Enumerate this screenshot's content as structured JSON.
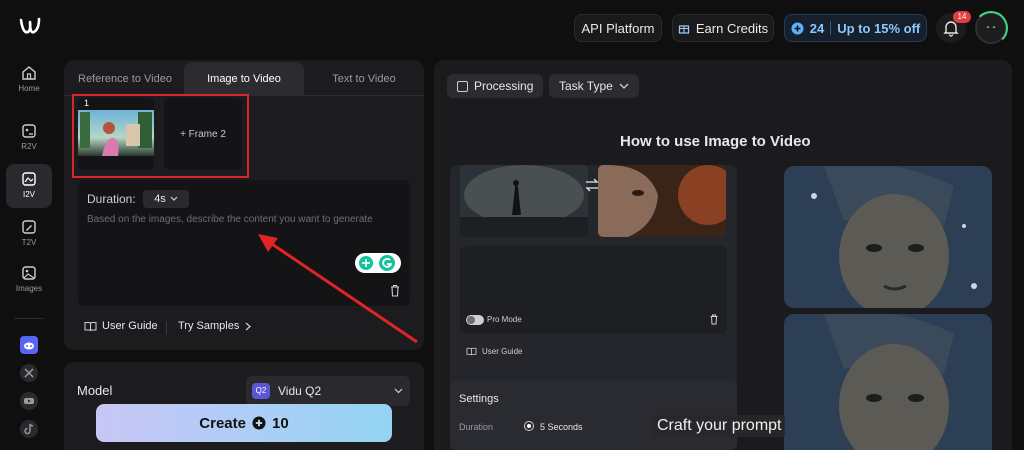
{
  "sidebar": {
    "items": [
      {
        "label": "Home",
        "icon": "home-icon"
      },
      {
        "label": "R2V",
        "icon": "r2v-icon"
      },
      {
        "label": "I2V",
        "icon": "i2v-icon",
        "active": true
      },
      {
        "label": "T2V",
        "icon": "t2v-icon"
      },
      {
        "label": "Images",
        "icon": "images-icon"
      }
    ]
  },
  "topbar": {
    "api": "API Platform",
    "earn": "Earn Credits",
    "credits": "24",
    "offer": "Up to 15% off",
    "notifications": "14",
    "avatar_text": "- -"
  },
  "left": {
    "tabs": [
      "Reference to Video",
      "Image to Video",
      "Text to Video"
    ],
    "frame1_index": "1",
    "frame2": "+ Frame 2",
    "duration_label": "Duration:",
    "duration_value": "4s",
    "placeholder": "Based on the images, describe the content you want to generate",
    "user_guide": "User Guide",
    "try_samples": "Try Samples"
  },
  "model": {
    "label": "Model",
    "value": "Vidu Q2",
    "badge": "Q2"
  },
  "create": {
    "label": "Create",
    "cost": "10"
  },
  "right": {
    "processing": "Processing",
    "task_type": "Task Type",
    "heading": "How to use Image to Video",
    "pro_mode": "Pro Mode",
    "user_guide": "User Guide",
    "settings": "Settings",
    "duration_label": "Duration",
    "duration_value": "5 Seconds",
    "caption": "Craft your prompt"
  },
  "colors": {
    "accent_red": "#d9262a",
    "badge_red": "#e33d3d",
    "credit_blue": "#5ab2ff",
    "green_ring": "#3ddc84"
  }
}
